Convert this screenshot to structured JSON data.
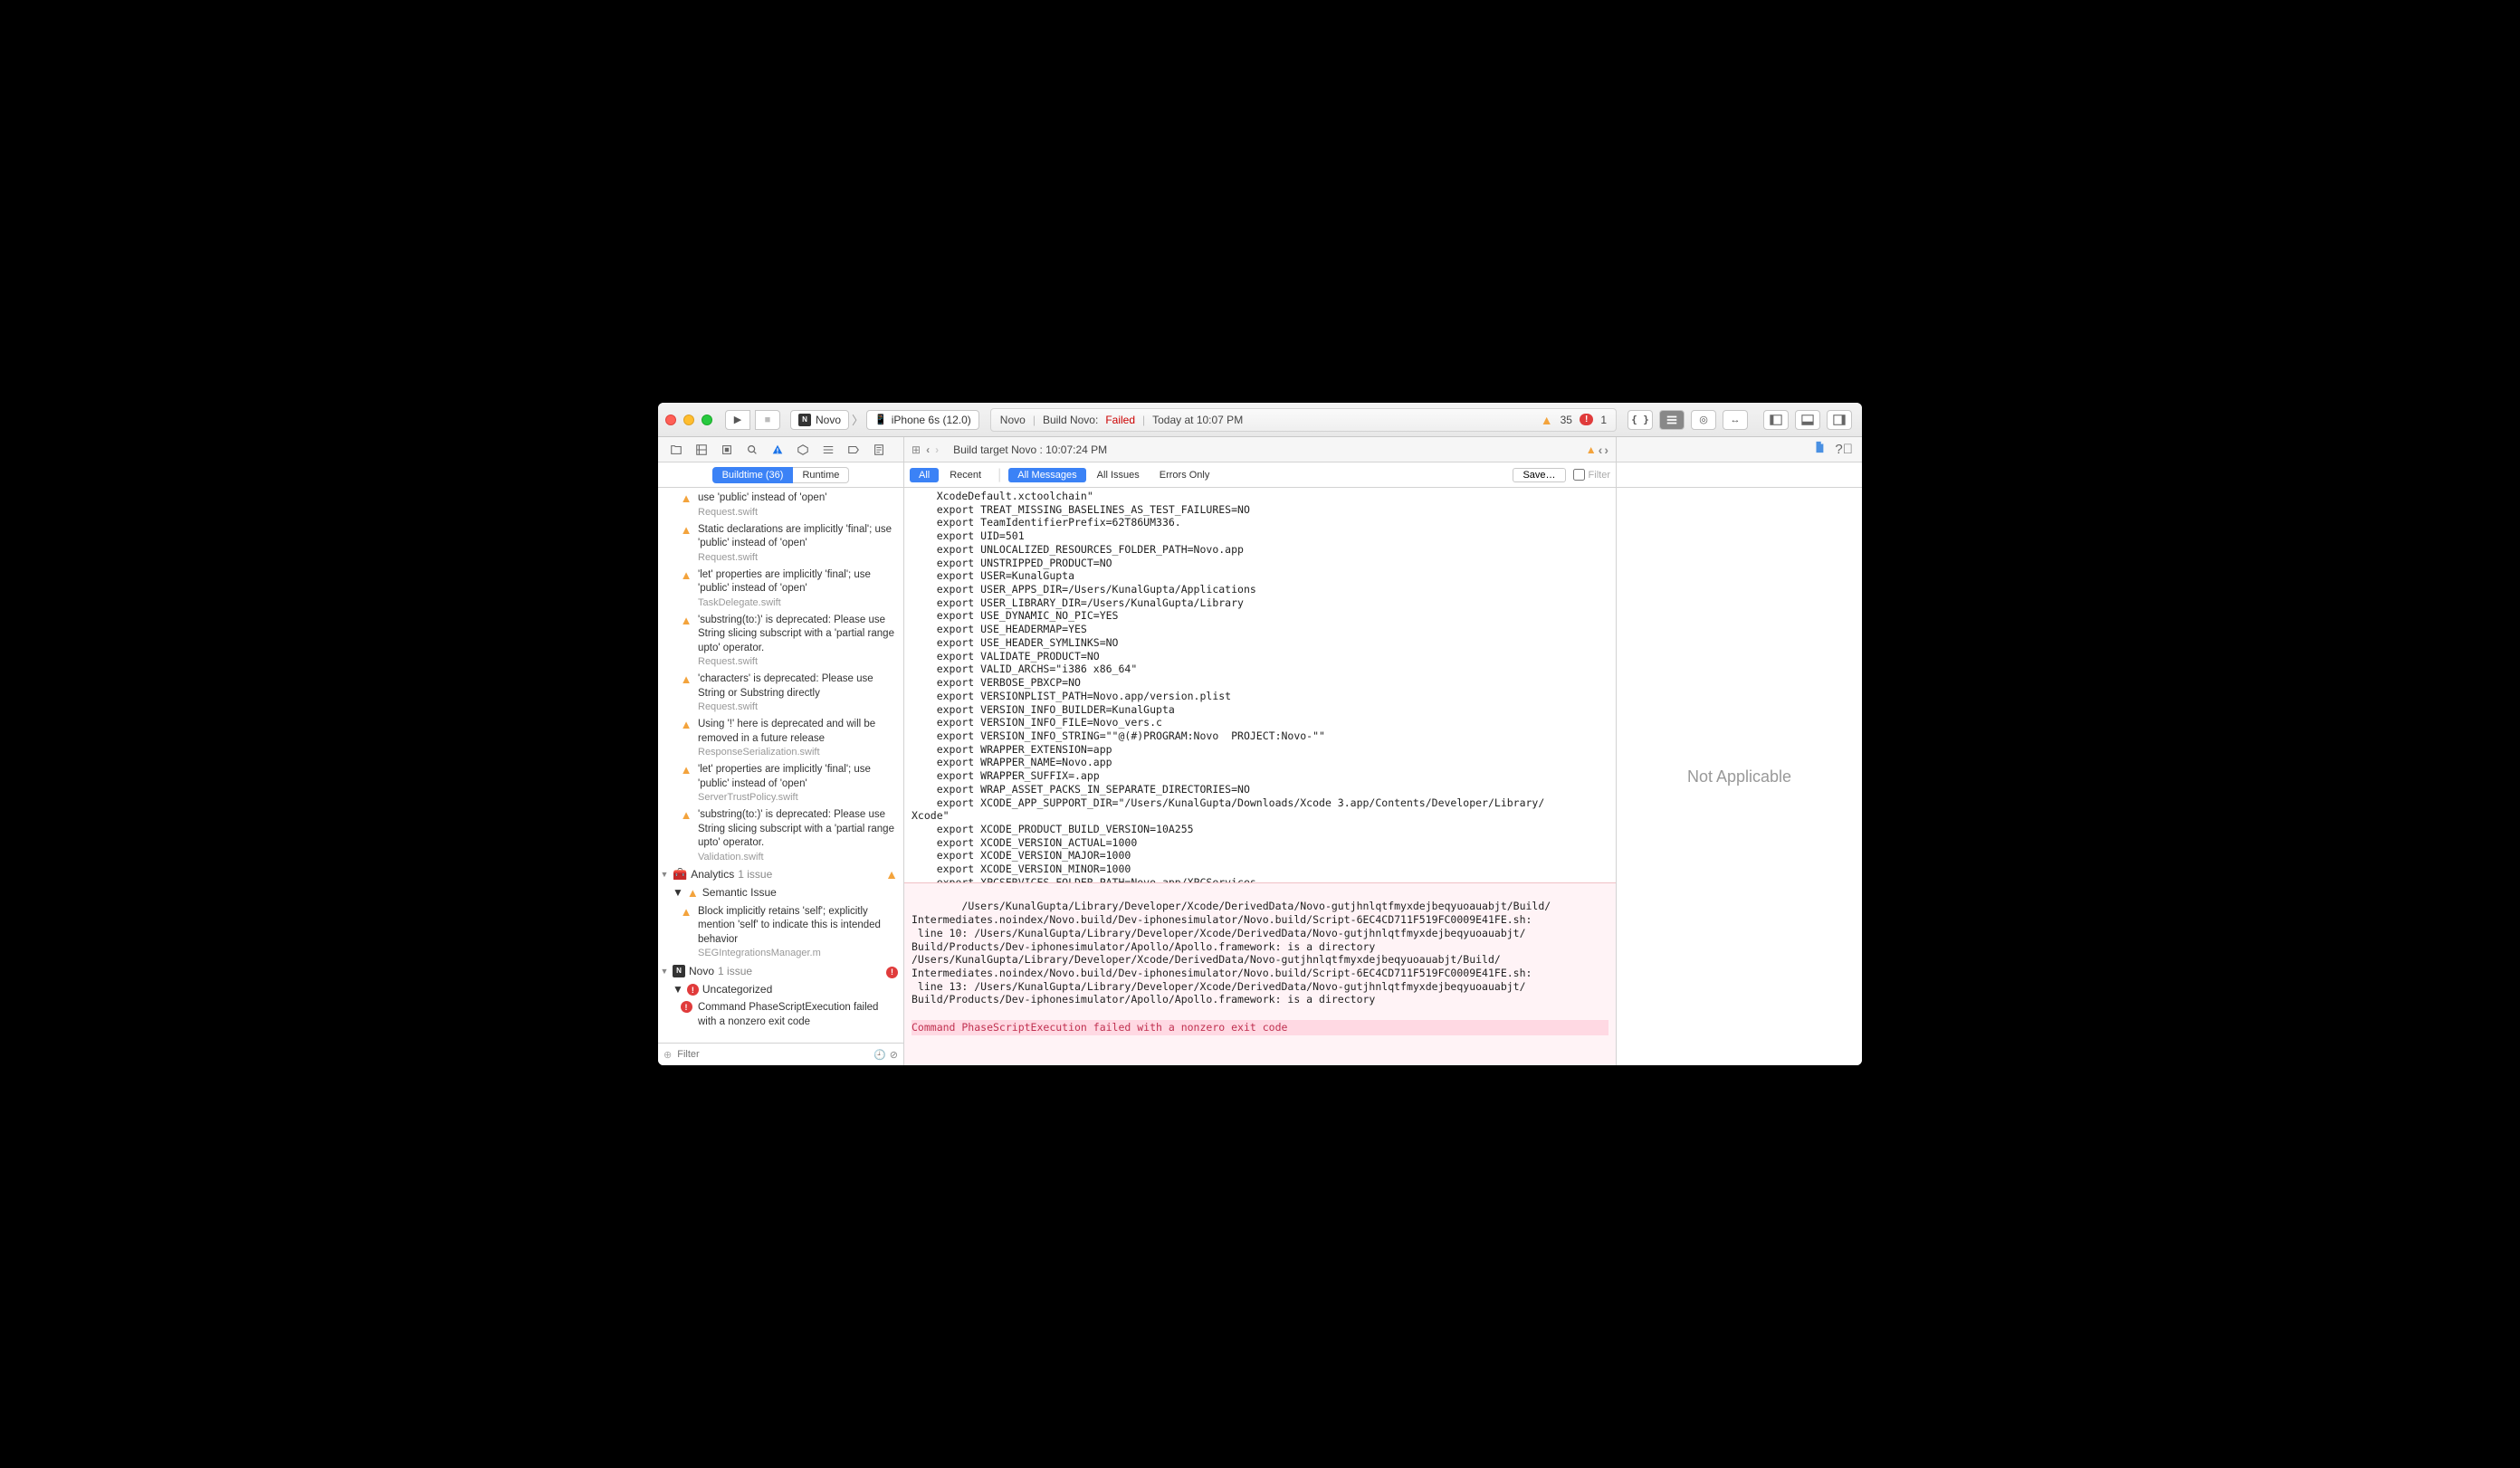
{
  "titlebar": {
    "scheme_app": "Novo",
    "scheme_device": "iPhone 6s (12.0)"
  },
  "status": {
    "project": "Novo",
    "build_prefix": "Build Novo:",
    "build_result": "Failed",
    "timestamp": "Today at 10:07 PM",
    "warn_count": "35",
    "error_count": "1"
  },
  "breadcrumb": {
    "label": "Build target Novo : 10:07:24 PM"
  },
  "arrows": {
    "warn": "⚠",
    "left": "‹",
    "right": "›"
  },
  "leftTabs": {
    "buildtime": "Buildtime (36)",
    "runtime": "Runtime"
  },
  "centerTabs": {
    "all": "All",
    "recent": "Recent",
    "allMessages": "All Messages",
    "allIssues": "All Issues",
    "errorsOnly": "Errors Only",
    "save": "Save…",
    "filter": "Filter"
  },
  "issues": [
    {
      "type": "warn",
      "msg": "use 'public' instead of 'open'",
      "file": "Request.swift"
    },
    {
      "type": "warn",
      "msg": "Static declarations are implicitly 'final'; use 'public' instead of 'open'",
      "file": "Request.swift"
    },
    {
      "type": "warn",
      "msg": "'let' properties are implicitly 'final'; use 'public' instead of 'open'",
      "file": "TaskDelegate.swift"
    },
    {
      "type": "warn",
      "msg": "'substring(to:)' is deprecated: Please use String slicing subscript with a 'partial range upto' operator.",
      "file": "Request.swift"
    },
    {
      "type": "warn",
      "msg": "'characters' is deprecated: Please use String or Substring directly",
      "file": "Request.swift"
    },
    {
      "type": "warn",
      "msg": "Using '!' here is deprecated and will be removed in a future release",
      "file": "ResponseSerialization.swift"
    },
    {
      "type": "warn",
      "msg": "'let' properties are implicitly 'final'; use 'public' instead of 'open'",
      "file": "ServerTrustPolicy.swift"
    },
    {
      "type": "warn",
      "msg": "'substring(to:)' is deprecated: Please use String slicing subscript with a 'partial range upto' operator.",
      "file": "Validation.swift"
    }
  ],
  "groups": {
    "analytics": {
      "label": "Analytics",
      "count": "1 issue"
    },
    "semantic": "Semantic Issue",
    "semIssue": {
      "msg": "Block implicitly retains 'self'; explicitly mention 'self' to indicate this is intended behavior",
      "file": "SEGIntegrationsManager.m"
    },
    "novo": {
      "label": "Novo",
      "count": "1 issue"
    },
    "uncategorized": "Uncategorized",
    "error": "Command PhaseScriptExecution failed with a nonzero exit code"
  },
  "filterFooter": {
    "placeholder": "Filter"
  },
  "rightPanel": "Not Applicable",
  "log_main": "    XcodeDefault.xctoolchain\"\n    export TREAT_MISSING_BASELINES_AS_TEST_FAILURES=NO\n    export TeamIdentifierPrefix=62T86UM336.\n    export UID=501\n    export UNLOCALIZED_RESOURCES_FOLDER_PATH=Novo.app\n    export UNSTRIPPED_PRODUCT=NO\n    export USER=KunalGupta\n    export USER_APPS_DIR=/Users/KunalGupta/Applications\n    export USER_LIBRARY_DIR=/Users/KunalGupta/Library\n    export USE_DYNAMIC_NO_PIC=YES\n    export USE_HEADERMAP=YES\n    export USE_HEADER_SYMLINKS=NO\n    export VALIDATE_PRODUCT=NO\n    export VALID_ARCHS=\"i386 x86_64\"\n    export VERBOSE_PBXCP=NO\n    export VERSIONPLIST_PATH=Novo.app/version.plist\n    export VERSION_INFO_BUILDER=KunalGupta\n    export VERSION_INFO_FILE=Novo_vers.c\n    export VERSION_INFO_STRING=\"\"@(#)PROGRAM:Novo  PROJECT:Novo-\"\"\n    export WRAPPER_EXTENSION=app\n    export WRAPPER_NAME=Novo.app\n    export WRAPPER_SUFFIX=.app\n    export WRAP_ASSET_PACKS_IN_SEPARATE_DIRECTORIES=NO\n    export XCODE_APP_SUPPORT_DIR=\"/Users/KunalGupta/Downloads/Xcode 3.app/Contents/Developer/Library/\nXcode\"\n    export XCODE_PRODUCT_BUILD_VERSION=10A255\n    export XCODE_VERSION_ACTUAL=1000\n    export XCODE_VERSION_MAJOR=1000\n    export XCODE_VERSION_MINOR=1000\n    export XPCSERVICES_FOLDER_PATH=Novo.app/XPCServices\n    export YACC=yacc\n    export arch=undefined_arch\n    export variant=normal\n    /bin/sh -c /Users/KunalGupta/Library/Developer/Xcode/DerivedData/Novo-gutjhnlqtfmyxdejbeqyuoauabjt/\nBuild/Intermediates.noindex/Novo.build/Dev-iphonesimulator/Novo.build/\nScript-6EC4CD711F519FC0009E41FE.sh",
  "log_err_body": "/Users/KunalGupta/Library/Developer/Xcode/DerivedData/Novo-gutjhnlqtfmyxdejbeqyuoauabjt/Build/\nIntermediates.noindex/Novo.build/Dev-iphonesimulator/Novo.build/Script-6EC4CD711F519FC0009E41FE.sh:\n line 10: /Users/KunalGupta/Library/Developer/Xcode/DerivedData/Novo-gutjhnlqtfmyxdejbeqyuoauabjt/\nBuild/Products/Dev-iphonesimulator/Apollo/Apollo.framework: is a directory\n/Users/KunalGupta/Library/Developer/Xcode/DerivedData/Novo-gutjhnlqtfmyxdejbeqyuoauabjt/Build/\nIntermediates.noindex/Novo.build/Dev-iphonesimulator/Novo.build/Script-6EC4CD711F519FC0009E41FE.sh:\n line 13: /Users/KunalGupta/Library/Developer/Xcode/DerivedData/Novo-gutjhnlqtfmyxdejbeqyuoauabjt/\nBuild/Products/Dev-iphonesimulator/Apollo/Apollo.framework: is a directory",
  "log_err_final": "Command PhaseScriptExecution failed with a nonzero exit code"
}
